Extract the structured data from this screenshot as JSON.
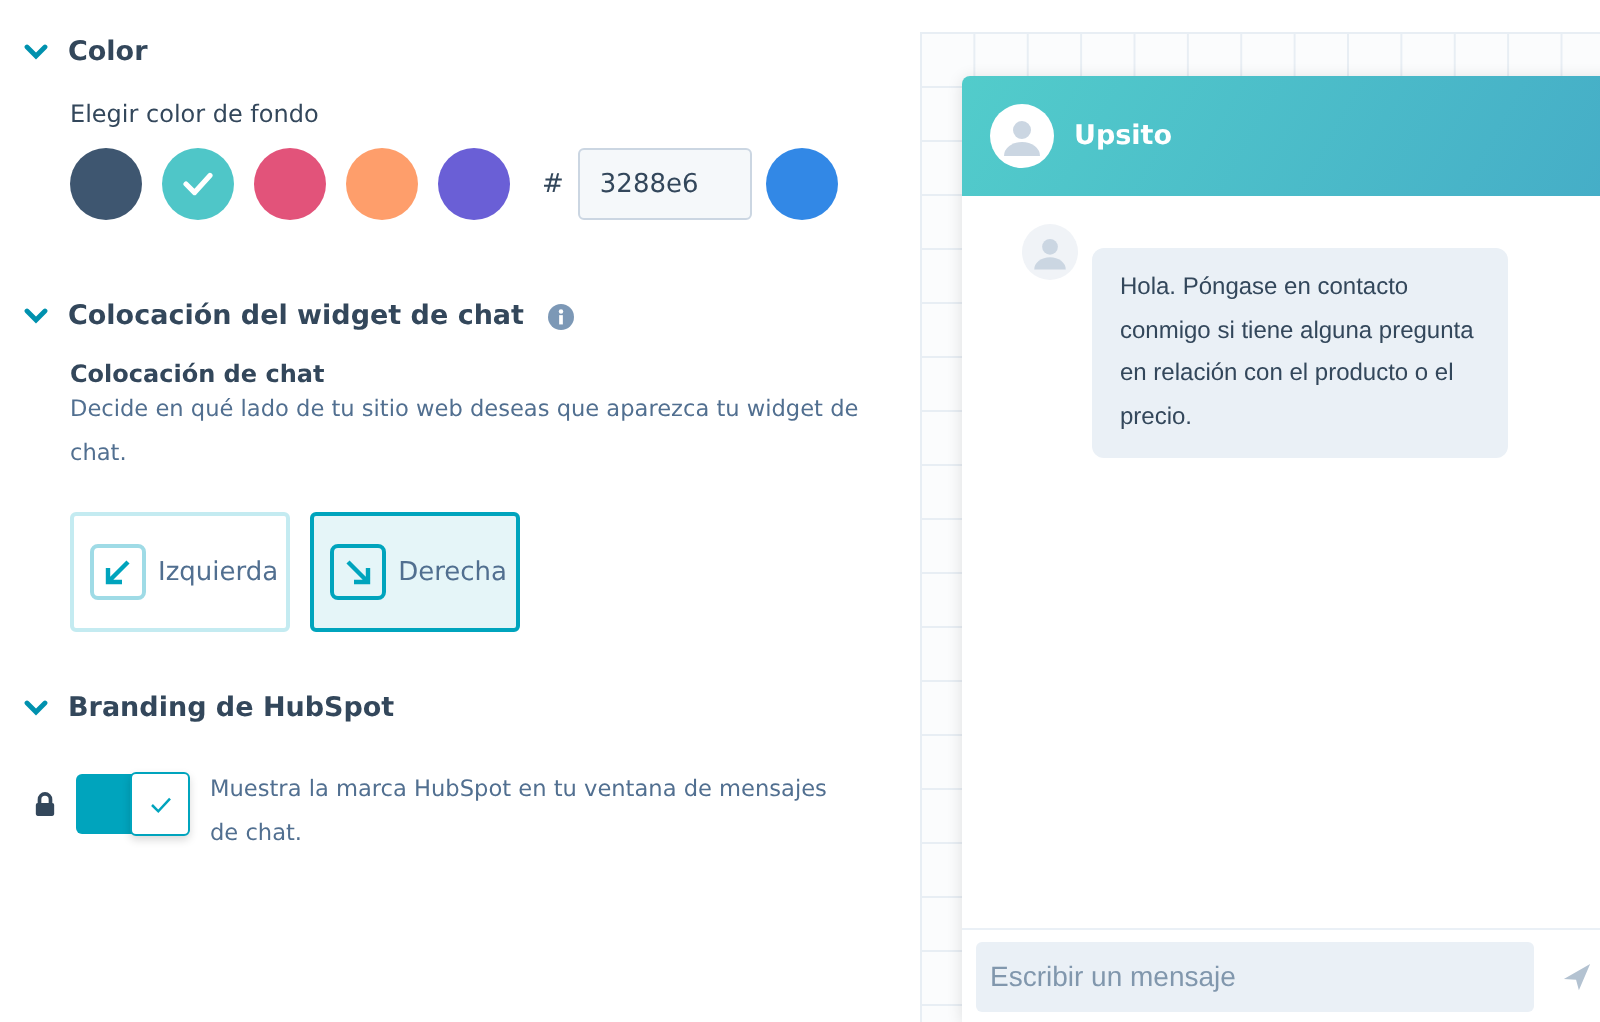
{
  "color_section": {
    "title": "Color",
    "expanded": true,
    "label": "Elegir color de fondo",
    "swatches": [
      {
        "color": "#3e5670",
        "selected": false
      },
      {
        "color": "#4fc6c8",
        "selected": true
      },
      {
        "color": "#e2537a",
        "selected": false
      },
      {
        "color": "#fe9e6b",
        "selected": false
      },
      {
        "color": "#6a5fd6",
        "selected": false
      }
    ],
    "hash": "#",
    "hex_value": "3288e6"
  },
  "placement_section": {
    "title": "Colocación del widget de chat",
    "expanded": true,
    "info": true,
    "sublabel": "Colocación de chat",
    "description": "Decide en qué lado de tu sitio web deseas que aparezca tu widget de chat.",
    "options": [
      {
        "kind": "left",
        "label": "Izquierda",
        "selected": false
      },
      {
        "kind": "right",
        "label": "Derecha",
        "selected": true
      }
    ]
  },
  "branding_section": {
    "title": "Branding de HubSpot",
    "expanded": true,
    "locked": true,
    "on": true,
    "description": "Muestra la marca HubSpot en tu ventana de mensajes de chat."
  },
  "chat": {
    "name": "Upsito",
    "message": "Hola. Póngase en contacto conmigo si tiene alguna pregunta en relación con el producto o el precio.",
    "placeholder": "Escribir un mensaje"
  }
}
